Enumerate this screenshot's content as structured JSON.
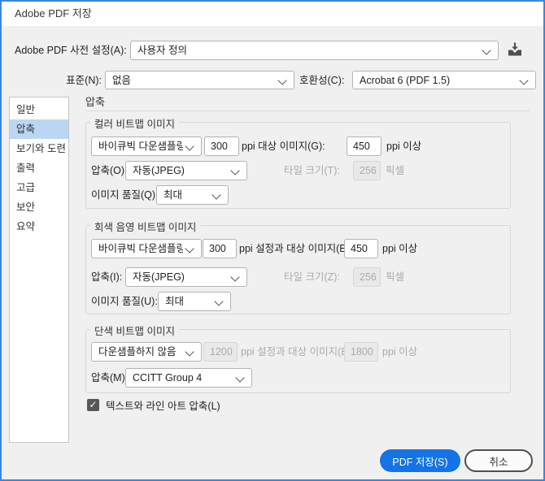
{
  "window": {
    "title": "Adobe PDF 저장"
  },
  "header": {
    "preset_label": "Adobe PDF 사전 설정(A):",
    "preset_value": "사용자 정의",
    "standard_label": "표준(N):",
    "standard_value": "없음",
    "compatibility_label": "호환성(C):",
    "compatibility_value": "Acrobat 6 (PDF 1.5)"
  },
  "sidebar": {
    "items": [
      {
        "label": "일반",
        "selected": false
      },
      {
        "label": "압축",
        "selected": true
      },
      {
        "label": "보기와 도련",
        "selected": false
      },
      {
        "label": "출력",
        "selected": false
      },
      {
        "label": "고급",
        "selected": false
      },
      {
        "label": "보안",
        "selected": false
      },
      {
        "label": "요약",
        "selected": false
      }
    ]
  },
  "panel": {
    "title": "압축",
    "color_group": {
      "legend": "컬러 비트맵 이미지",
      "sampling_value": "바이큐빅 다운샘플링",
      "sampling_ppi": "300",
      "target_label": "ppi 대상 이미지(G):",
      "target_ppi": "450",
      "above_label": "ppi 이상",
      "compression_label": "압축(O):",
      "compression_value": "자동(JPEG)",
      "tile_label": "타일 크기(T):",
      "tile_value": "256",
      "tile_unit": "픽셀",
      "quality_label": "이미지 품질(Q):",
      "quality_value": "최대"
    },
    "gray_group": {
      "legend": "회색 음영 비트맵 이미지",
      "sampling_value": "바이큐빅 다운샘플링",
      "sampling_ppi": "300",
      "target_label": "ppi 설정과 대상 이미지(E)",
      "target_ppi": "450",
      "above_label": "ppi 이상",
      "compression_label": "압축(I):",
      "compression_value": "자동(JPEG)",
      "tile_label": "타일 크기(Z):",
      "tile_value": "256",
      "tile_unit": "픽셀",
      "quality_label": "이미지 품질(U):",
      "quality_value": "최대"
    },
    "mono_group": {
      "legend": "단색 비트맵 이미지",
      "sampling_value": "다운샘플하지 않음",
      "sampling_ppi": "1200",
      "target_label": "ppi 설정과 대상 이미지(B)",
      "target_ppi": "1800",
      "above_label": "ppi 이상",
      "compression_label": "압축(M):",
      "compression_value": "CCITT Group 4"
    },
    "text_lineart": {
      "label": "텍스트와 라인 아트 압축(L)",
      "checked": true,
      "checkmark": "✓"
    }
  },
  "footer": {
    "save_label": "PDF 저장(S)",
    "cancel_label": "취소"
  },
  "icons": {
    "save_preset": "save-preset-download-icon",
    "dropdown": "chevron-down-icon"
  },
  "colors": {
    "dialog_border": "#3a86de",
    "accent_button": "#1473e6",
    "sidebar_selection": "#b9d7f2",
    "background": "#f0f0f0"
  }
}
